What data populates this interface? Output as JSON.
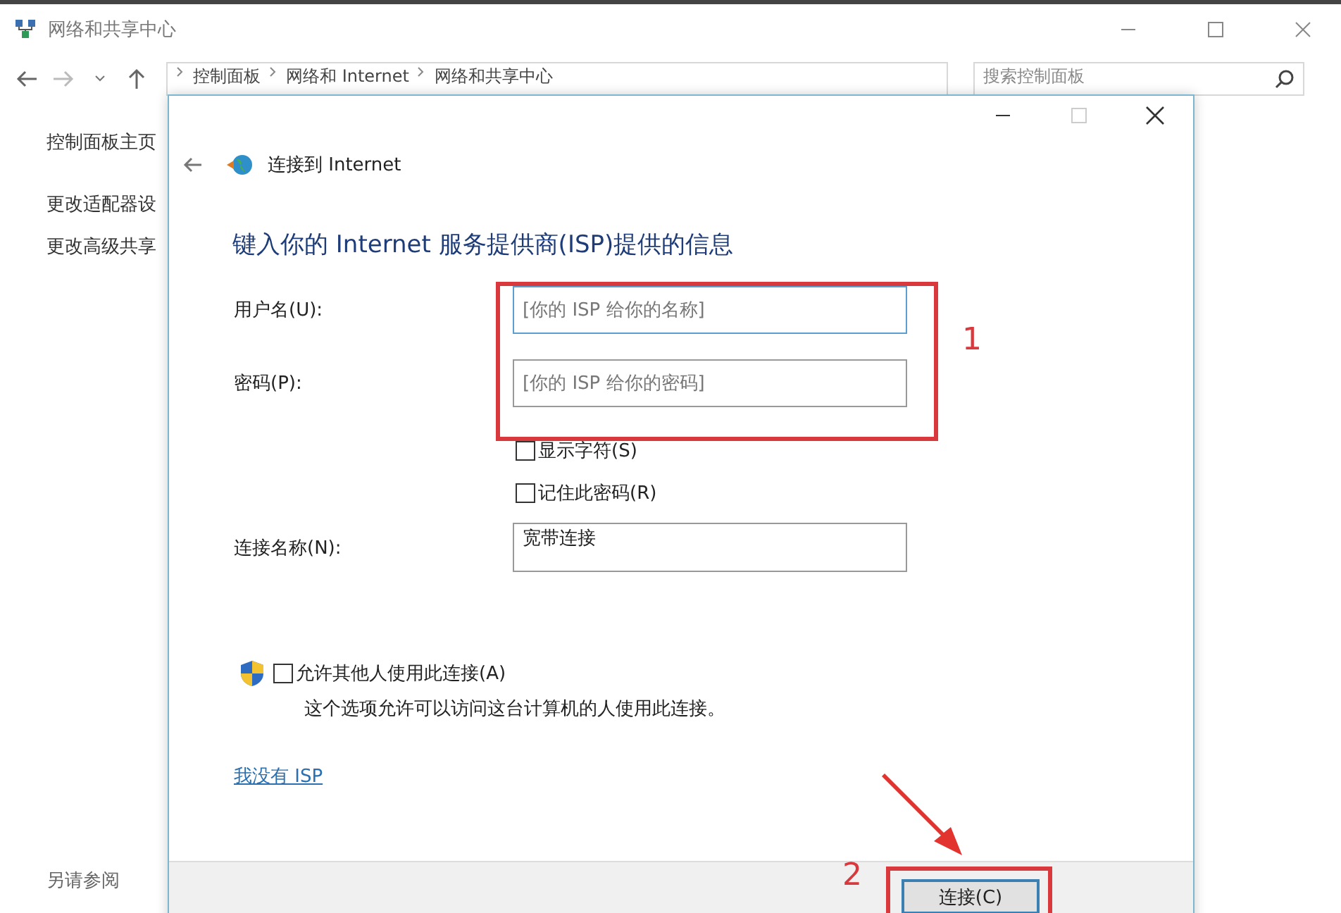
{
  "background_window": {
    "title": "网络和共享中心",
    "address_bar": [
      "控制面板",
      "网络和 Internet",
      "网络和共享中心"
    ],
    "search": {
      "placeholder": "搜索控制面板"
    },
    "sidebar": {
      "items": [
        "控制面板主页",
        "更改适配器设",
        "更改高级共享"
      ],
      "see_also": "另请参阅"
    }
  },
  "dialog": {
    "title": "连接到 Internet",
    "heading": "键入你的 Internet 服务提供商(ISP)提供的信息",
    "fields": [
      {
        "label": "用户名(U):",
        "placeholder": "[你的 ISP 给你的名称]",
        "focused": true
      },
      {
        "label": "密码(P):",
        "placeholder": "[你的 ISP 给你的密码]",
        "focused": false
      }
    ],
    "options": [
      {
        "label": "显示字符(S)",
        "checked": false
      },
      {
        "label": "记住此密码(R)",
        "checked": false
      }
    ],
    "connection_name": {
      "label": "连接名称(N):",
      "value": "宽带连接"
    },
    "allow_others": {
      "label": "允许其他人使用此连接(A)",
      "checked": false,
      "description": "这个选项允许可以访问这台计算机的人使用此连接。"
    },
    "link": "我没有 ISP",
    "buttons": [
      "连接(C)"
    ]
  },
  "annotations": [
    {
      "label": "1"
    },
    {
      "label": "2"
    }
  ]
}
